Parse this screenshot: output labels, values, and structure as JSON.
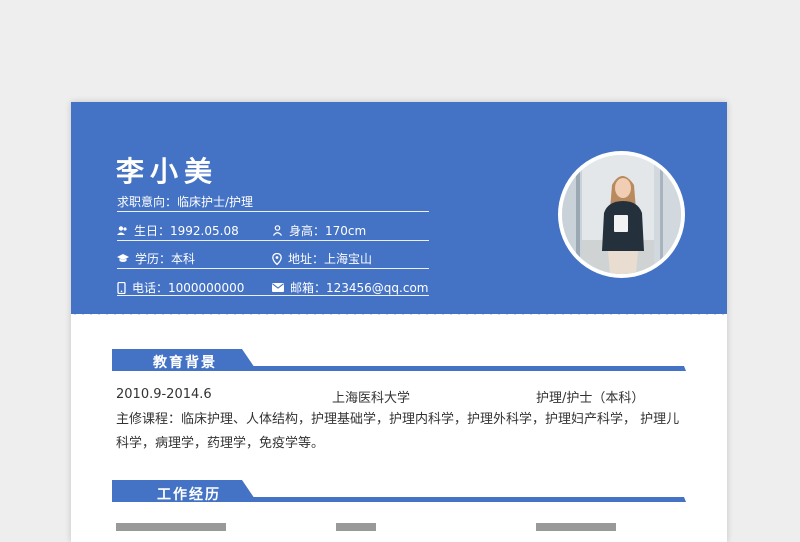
{
  "resume": {
    "name": "李小美",
    "objective": "求职意向：临床护士/护理",
    "info": {
      "birthday": "生日：1992.05.08",
      "height": "身高：170cm",
      "education": "学历：本科",
      "address": "地址：上海宝山",
      "phone": "电话：1000000000",
      "email": "邮箱：123456@qq.com"
    },
    "sections": {
      "education_title": "教育背景",
      "work_title": "工作经历"
    },
    "education": {
      "period": "2010.9-2014.6",
      "school": "上海医科大学",
      "major": "护理/护士（本科）",
      "courses": "主修课程：临床护理、人体结构，护理基础学，护理内科学，护理外科学，护理妇产科学， 护理儿科学，病理学，药理学，免疫学等。"
    }
  },
  "colors": {
    "accent": "#4472c4",
    "background": "#eeeeee",
    "text": "#333333"
  }
}
